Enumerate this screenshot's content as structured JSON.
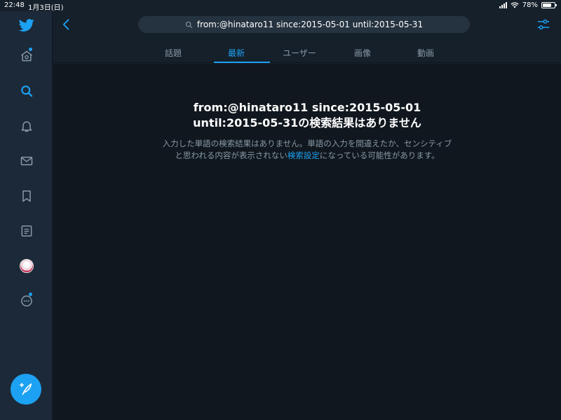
{
  "status": {
    "time": "22:48",
    "date": "1月3日(日)",
    "battery": "78%",
    "battery_level": 0.78
  },
  "sidebar": {
    "items": [
      {
        "name": "twitter-logo",
        "icon": "bird-icon"
      },
      {
        "name": "home",
        "icon": "home-icon",
        "has_dot": true
      },
      {
        "name": "explore",
        "icon": "search-icon",
        "active": true
      },
      {
        "name": "notifications",
        "icon": "bell-icon"
      },
      {
        "name": "messages",
        "icon": "mail-icon"
      },
      {
        "name": "bookmarks",
        "icon": "bookmark-icon"
      },
      {
        "name": "lists",
        "icon": "list-icon"
      },
      {
        "name": "profile",
        "icon": "avatar"
      },
      {
        "name": "more",
        "icon": "more-icon",
        "has_dot": true
      }
    ],
    "compose_icon": "feather-plus-icon"
  },
  "header": {
    "search_query": "from:@hinataro11 since:2015-05-01 until:2015-05-31",
    "tabs": [
      {
        "label": "話題",
        "active": false
      },
      {
        "label": "最新",
        "active": true
      },
      {
        "label": "ユーザー",
        "active": false
      },
      {
        "label": "画像",
        "active": false
      },
      {
        "label": "動画",
        "active": false
      }
    ]
  },
  "main": {
    "empty_title_line1": "from:@hinataro11 since:2015-05-01",
    "empty_title_line2": "until:2015-05-31の検索結果はありません",
    "desc_line1": "入力した単語の検索結果はありません。単語の入力を間違えたか、センシティブ",
    "desc_line2_pre": "と思われる内容が表示されない",
    "desc_link": "検索設定",
    "desc_line2_post": "になっている可能性があります。"
  },
  "colors": {
    "accent": "#1da1f2",
    "background": "#10171e",
    "sidebar": "#1c2938",
    "muted_text": "#8899a6"
  }
}
